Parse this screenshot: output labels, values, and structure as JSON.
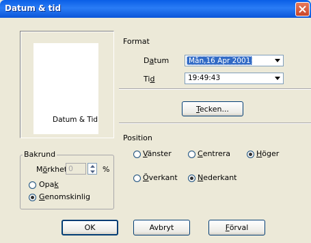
{
  "window": {
    "title": "Datum & tid"
  },
  "preview": {
    "label": "Datum & Tid"
  },
  "format": {
    "heading": "Format",
    "datum_label": "Datum",
    "datum_value": "Mån,16 Apr 2001",
    "tid_label": "Tid",
    "tid_value": "19:49:43",
    "tecken_button": "Tecken..."
  },
  "position": {
    "heading": "Position",
    "horizontal": [
      "Vänster",
      "Centrera",
      "Höger"
    ],
    "horizontal_selected": "Höger",
    "vertical": [
      "Överkant",
      "Nederkant"
    ],
    "vertical_selected": "Nederkant"
  },
  "bakrund": {
    "heading": "Bakrund",
    "morkhet_label": "Mörkhet",
    "morkhet_value": "0",
    "percent": "%",
    "options": [
      "Opak",
      "Genomskinlig"
    ],
    "selected": "Genomskinlig"
  },
  "buttons": {
    "ok": "OK",
    "avbryt": "Avbryt",
    "forval": "Förval"
  },
  "icons": {
    "close": "close-icon",
    "dropdown": "chevron-down-icon",
    "spin_up": "spin-up-icon",
    "spin_down": "spin-down-icon"
  }
}
